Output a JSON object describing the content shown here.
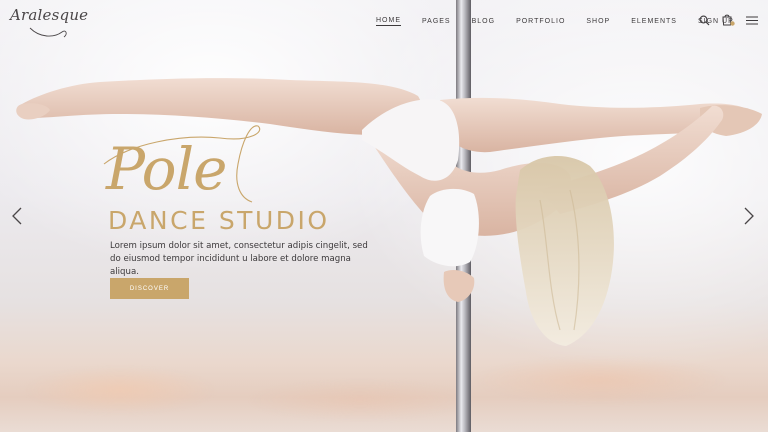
{
  "header": {
    "logo_text": "Aralesque",
    "nav": [
      {
        "label": "HOME",
        "active": true
      },
      {
        "label": "PAGES"
      },
      {
        "label": "BLOG"
      },
      {
        "label": "PORTFOLIO"
      },
      {
        "label": "SHOP"
      },
      {
        "label": "ELEMENTS"
      },
      {
        "label": "SIGN UP"
      }
    ],
    "icons": [
      "search-icon",
      "cart-icon",
      "menu-icon"
    ],
    "cart_badge_color": "#c9a66b"
  },
  "hero": {
    "script_title": "Pole",
    "headline": "DANCE STUDIO",
    "body": "Lorem ipsum dolor sit amet, consectetur adipis cingelit, sed do eiusmod tempor incididunt u labore et dolore magna aliqua.",
    "cta_label": "DISCOVER",
    "accent_color": "#c9a66b",
    "background_image": "dancer-on-pole-photo"
  },
  "slider": {
    "prev_icon": "chevron-left-icon",
    "next_icon": "chevron-right-icon"
  }
}
